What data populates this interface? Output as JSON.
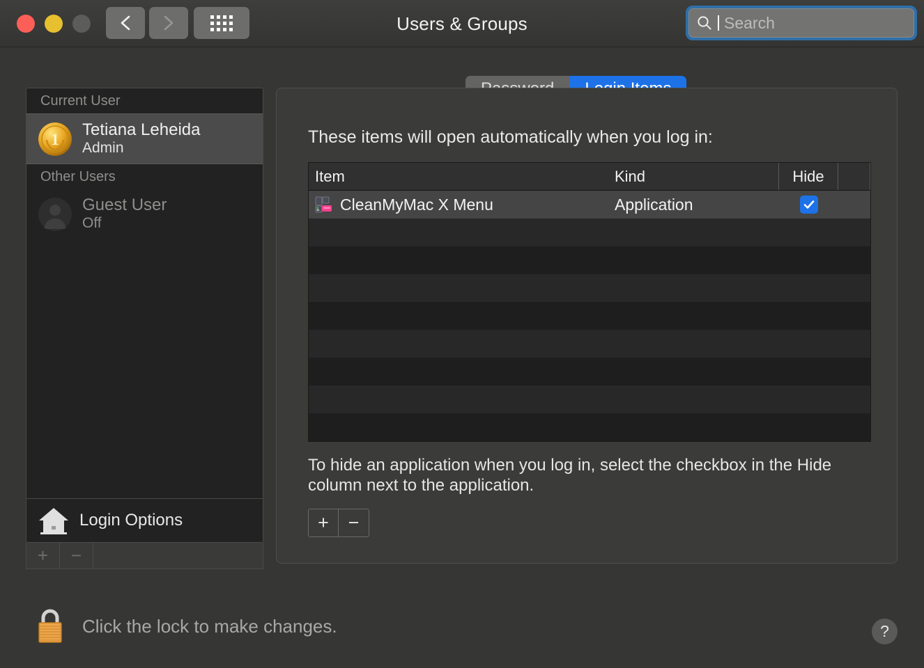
{
  "window": {
    "title": "Users & Groups",
    "traffic_lights": [
      "close",
      "minimize",
      "zoom"
    ],
    "back_label": "Back",
    "forward_label": "Forward",
    "grid_label": "Show All"
  },
  "search": {
    "placeholder": "Search",
    "value": "",
    "focused": true,
    "focus_ring_color": "#2f6fa8"
  },
  "sidebar": {
    "current_user_header": "Current User",
    "other_users_header": "Other Users",
    "current_user": {
      "name": "Tetiana Leheida",
      "role": "Admin",
      "avatar": "gold-medal-avatar",
      "selected": true
    },
    "other_users": [
      {
        "name": "Guest User",
        "status": "Off",
        "avatar": "person-silhouette-avatar",
        "selected": false
      }
    ],
    "login_options_label": "Login Options",
    "add_label": "+",
    "remove_label": "−"
  },
  "tabs": [
    {
      "label": "Password",
      "active": false
    },
    {
      "label": "Login Items",
      "active": true
    }
  ],
  "main": {
    "heading": "These items will open automatically when you log in:",
    "columns": [
      "Item",
      "Kind",
      "Hide"
    ],
    "rows": [
      {
        "item": "CleanMyMac X Menu",
        "kind": "Application",
        "hide": true,
        "icon": "cleanmymac-x-menu-icon",
        "selected": true
      }
    ],
    "empty_row_count": 8,
    "note": "To hide an application when you log in, select the checkbox in the Hide column next to the application.",
    "add_label": "+",
    "remove_label": "−"
  },
  "footer": {
    "lock_text": "Click the lock to make changes.",
    "lock_state": "locked",
    "help_label": "?"
  },
  "colors": {
    "accent_blue": "#1d72e8",
    "window_bg": "#363634",
    "panel_bg": "#3b3b39",
    "table_bg": "#1e1e1e",
    "selected_row": "#454545",
    "lock_gold": "#e8a33d"
  }
}
